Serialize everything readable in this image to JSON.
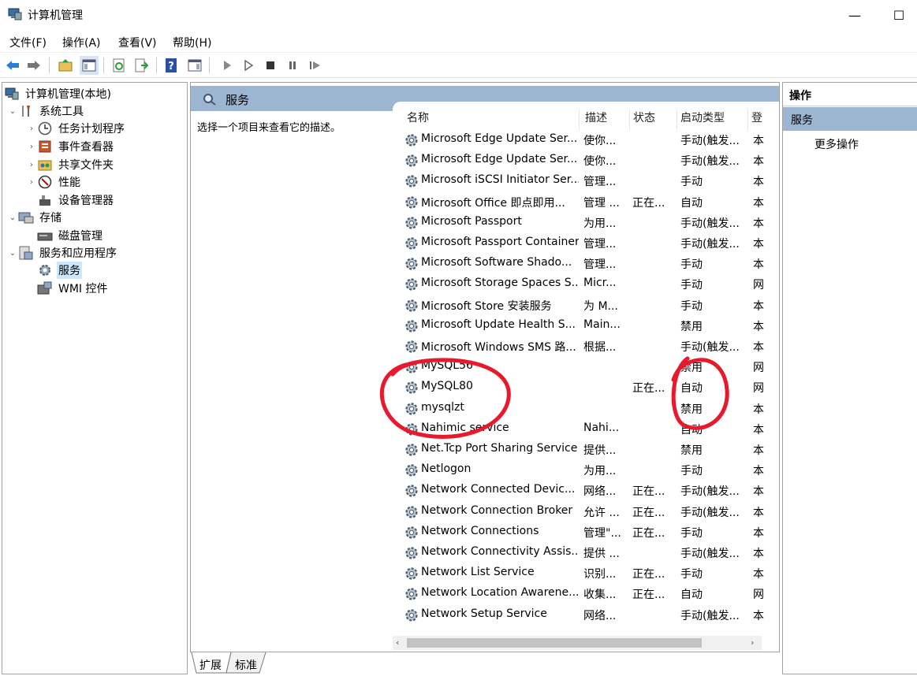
{
  "window": {
    "title": "计算机管理",
    "minimize": "—",
    "maximize": "☐"
  },
  "menu": [
    "文件(F)",
    "操作(A)",
    "查看(V)",
    "帮助(H)"
  ],
  "tree": [
    {
      "label": "计算机管理(本地)",
      "icon": "computer-management-icon"
    },
    {
      "label": "系统工具",
      "icon": "tools-icon"
    },
    {
      "label": "任务计划程序",
      "icon": "clock-icon"
    },
    {
      "label": "事件查看器",
      "icon": "event-viewer-icon"
    },
    {
      "label": "共享文件夹",
      "icon": "shared-folder-icon"
    },
    {
      "label": "性能",
      "icon": "performance-icon"
    },
    {
      "label": "设备管理器",
      "icon": "device-manager-icon"
    },
    {
      "label": "存储",
      "icon": "storage-icon"
    },
    {
      "label": "磁盘管理",
      "icon": "disk-icon"
    },
    {
      "label": "服务和应用程序",
      "icon": "services-apps-icon"
    },
    {
      "label": "服务",
      "icon": "gear-icon"
    },
    {
      "label": "WMI 控件",
      "icon": "wmi-icon"
    }
  ],
  "center": {
    "title": "服务",
    "description": "选择一个项目来查看它的描述。",
    "columns": [
      "名称",
      "描述",
      "状态",
      "启动类型",
      "登"
    ],
    "rows": [
      [
        "Microsoft Edge Update Ser...",
        "使你...",
        "",
        "手动(触发...",
        "本"
      ],
      [
        "Microsoft Edge Update Ser...",
        "使你...",
        "",
        "手动(触发...",
        "本"
      ],
      [
        "Microsoft iSCSI Initiator Ser...",
        "管理...",
        "",
        "手动",
        "本"
      ],
      [
        "Microsoft Office 即点即用...",
        "管理 ...",
        "正在...",
        "自动",
        "本"
      ],
      [
        "Microsoft Passport",
        "为用...",
        "",
        "手动(触发...",
        "本"
      ],
      [
        "Microsoft Passport Container",
        "管理...",
        "",
        "手动(触发...",
        "本"
      ],
      [
        "Microsoft Software Shado...",
        "管理...",
        "",
        "手动",
        "本"
      ],
      [
        "Microsoft Storage Spaces S...",
        "Micr...",
        "",
        "手动",
        "网"
      ],
      [
        "Microsoft Store 安装服务",
        "为 M...",
        "",
        "手动",
        "本"
      ],
      [
        "Microsoft Update Health S...",
        "Main...",
        "",
        "禁用",
        "本"
      ],
      [
        "Microsoft Windows SMS 路...",
        "根据...",
        "",
        "手动(触发...",
        "本"
      ],
      [
        "MySQL56",
        "",
        "",
        "禁用",
        "网"
      ],
      [
        "MySQL80",
        "",
        "正在...",
        "自动",
        "网"
      ],
      [
        "mysqlzt",
        "",
        "",
        "禁用",
        "本"
      ],
      [
        "Nahimic service",
        "Nahi...",
        "",
        "自动",
        "本"
      ],
      [
        "Net.Tcp Port Sharing Service",
        "提供...",
        "",
        "禁用",
        "本"
      ],
      [
        "Netlogon",
        "为用...",
        "",
        "手动",
        "本"
      ],
      [
        "Network Connected Devic...",
        "网络...",
        "正在...",
        "手动(触发...",
        "本"
      ],
      [
        "Network Connection Broker",
        "允许 ...",
        "正在...",
        "手动(触发...",
        "本"
      ],
      [
        "Network Connections",
        "管理\"...",
        "正在...",
        "手动",
        "本"
      ],
      [
        "Network Connectivity Assis...",
        "提供 ...",
        "",
        "手动(触发...",
        "本"
      ],
      [
        "Network List Service",
        "识别...",
        "正在...",
        "手动",
        "本"
      ],
      [
        "Network Location Awarene...",
        "收集...",
        "正在...",
        "自动",
        "网"
      ],
      [
        "Network Setup Service",
        "网络...",
        "",
        "手动(触发...",
        "本"
      ]
    ]
  },
  "bottom_tabs": [
    "扩展",
    "标准"
  ],
  "actions": {
    "header": "操作",
    "selected": "服务",
    "more": "更多操作"
  },
  "colors": {
    "header_blue": "#9cb5d0",
    "selection": "#cce8ff",
    "annotation_red": "#e8192c"
  }
}
